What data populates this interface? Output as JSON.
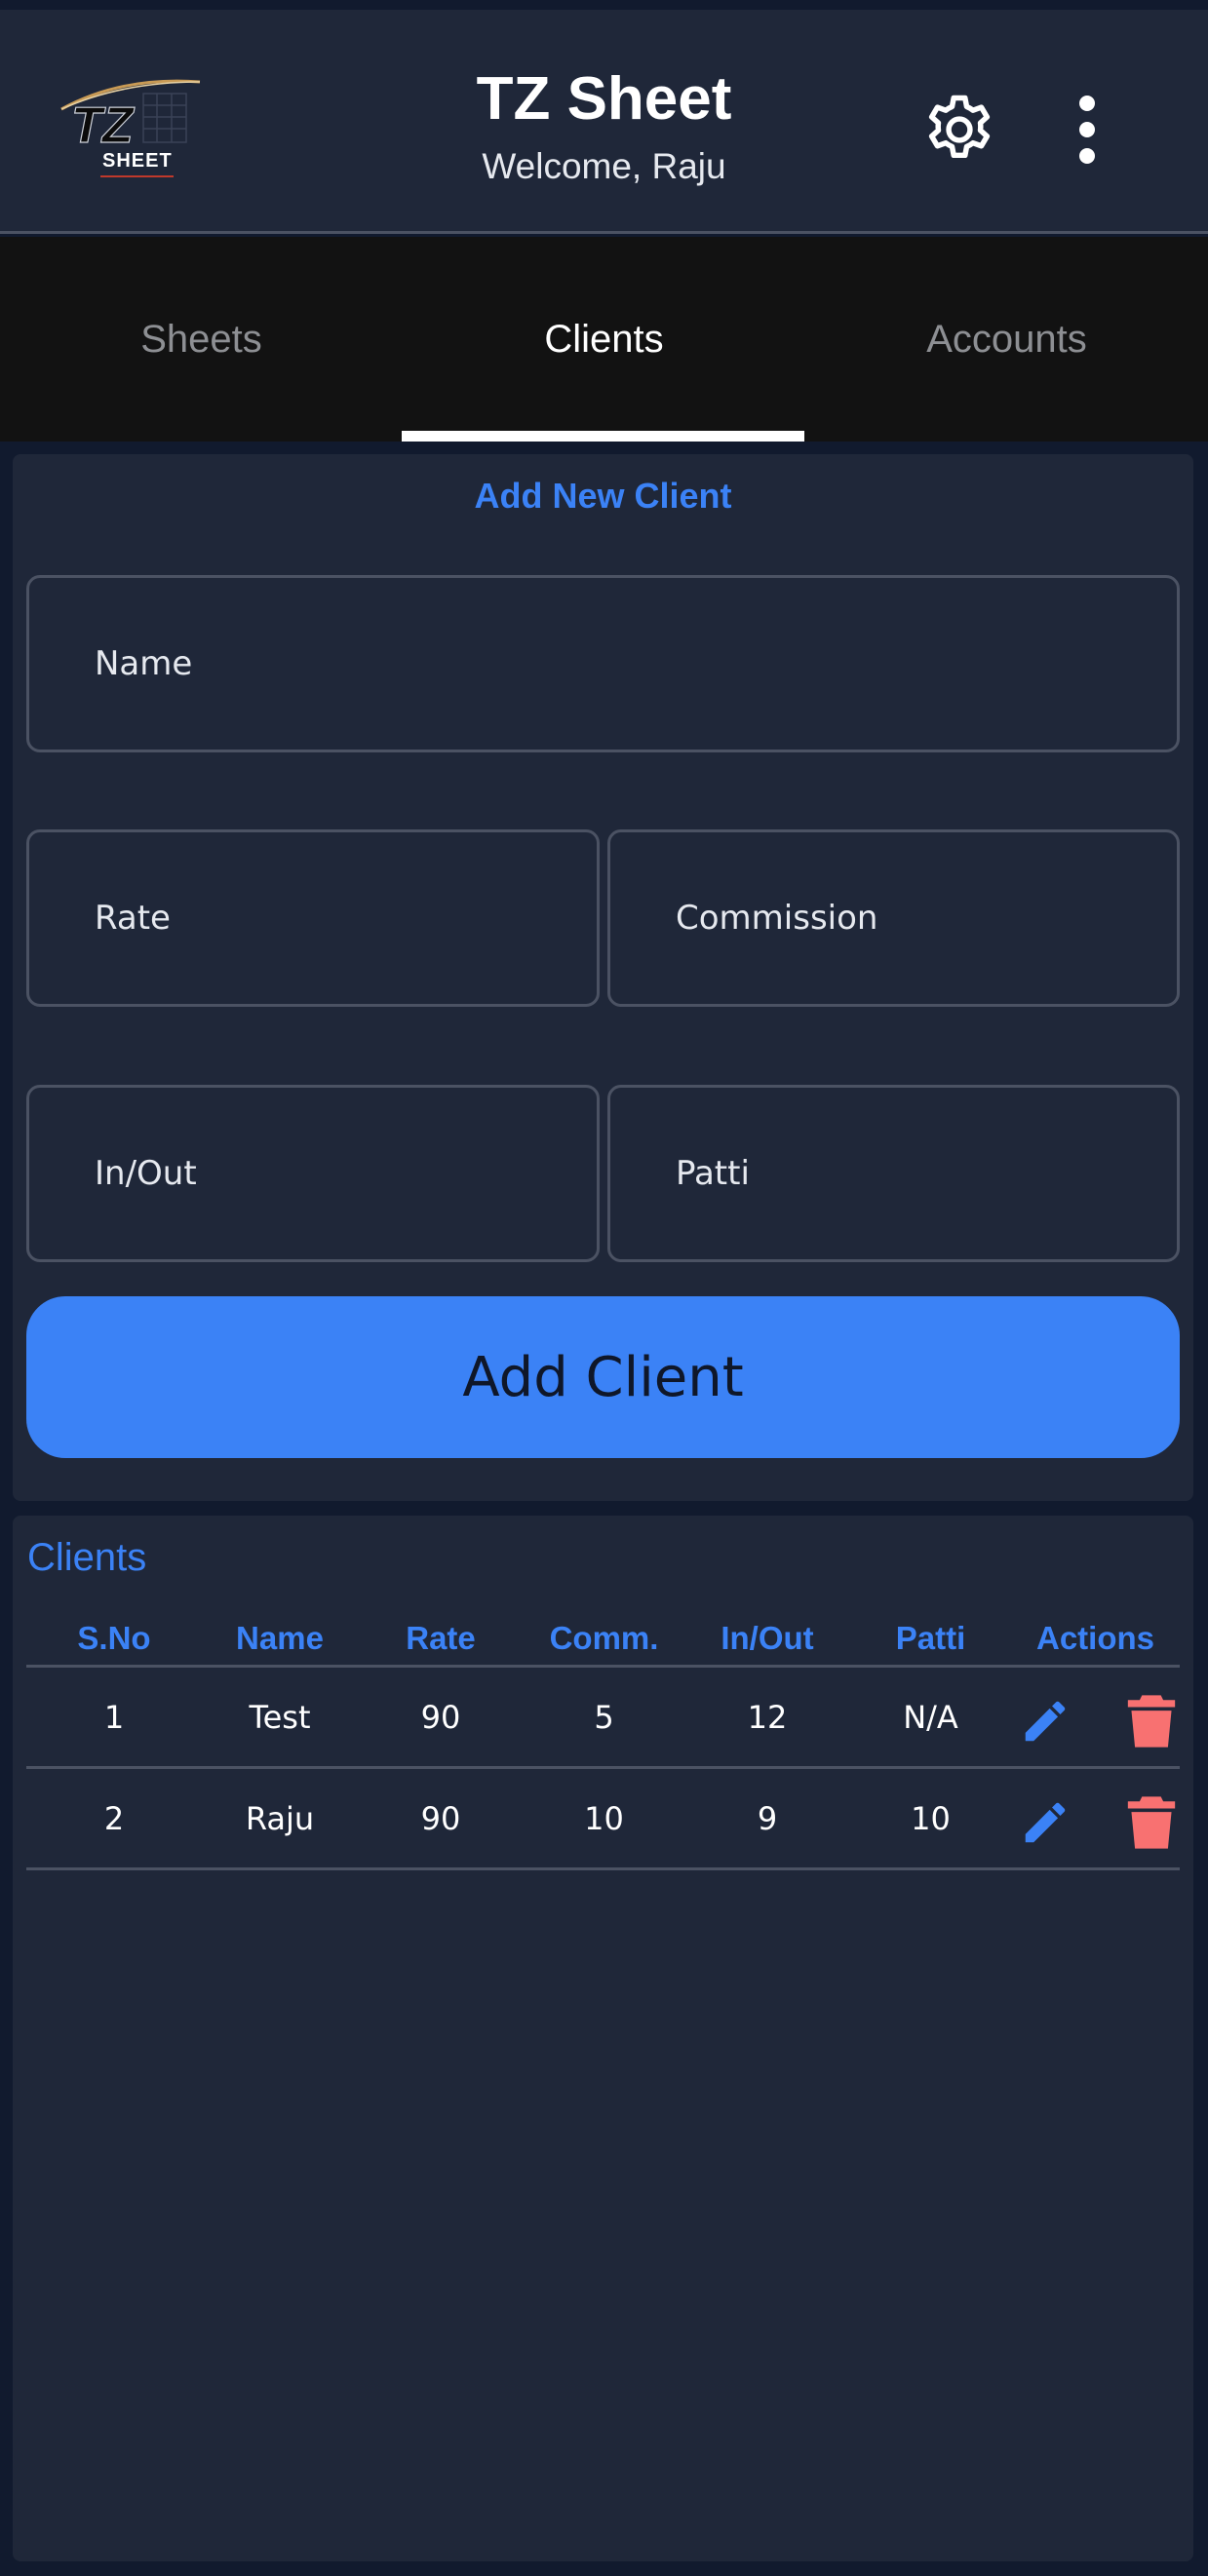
{
  "app": {
    "title": "TZ Sheet",
    "welcome": "Welcome, Raju",
    "logo_text_main": "TZ",
    "logo_text_sub": "SHEET"
  },
  "tabs": [
    {
      "label": "Sheets",
      "active": false
    },
    {
      "label": "Clients",
      "active": true
    },
    {
      "label": "Accounts",
      "active": false
    }
  ],
  "form": {
    "heading": "Add New Client",
    "fields": {
      "name": "Name",
      "rate": "Rate",
      "commission": "Commission",
      "inout": "In/Out",
      "patti": "Patti"
    },
    "submit_label": "Add Client"
  },
  "clients": {
    "title": "Clients",
    "columns": [
      "S.No",
      "Name",
      "Rate",
      "Comm.",
      "In/Out",
      "Patti",
      "Actions"
    ],
    "rows": [
      {
        "sno": "1",
        "name": "Test",
        "rate": "90",
        "comm": "5",
        "inout": "12",
        "patti": "N/A"
      },
      {
        "sno": "2",
        "name": "Raju",
        "rate": "90",
        "comm": "10",
        "inout": "9",
        "patti": "10"
      }
    ]
  },
  "icons": {
    "settings": "gear-icon",
    "menu": "more-vertical-icon",
    "edit": "pencil-icon",
    "delete": "trash-icon"
  },
  "colors": {
    "accent": "#3b82f6",
    "background": "#1f2739",
    "delete": "#f87171",
    "tab_bar": "#121212"
  }
}
